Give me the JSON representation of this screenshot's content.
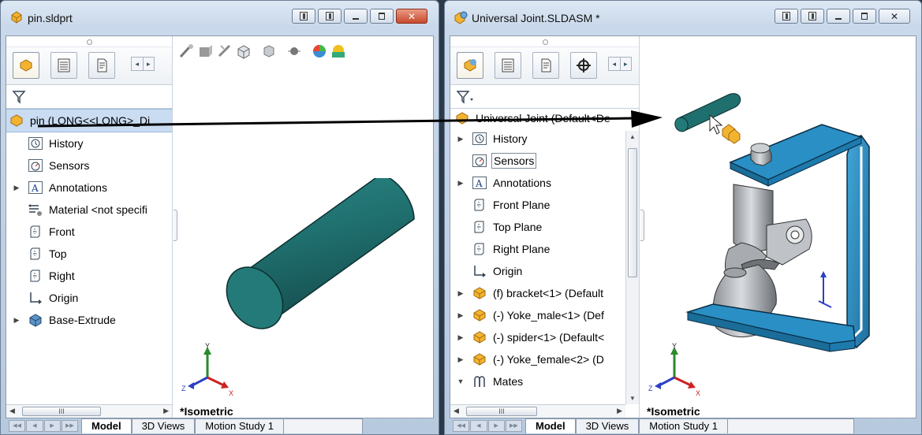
{
  "left_window": {
    "title": "pin.sldprt",
    "root_node": "pin (LONG<<LONG>_Di",
    "tree": [
      {
        "label": "History",
        "icon": "history-icon",
        "expander": ""
      },
      {
        "label": "Sensors",
        "icon": "sensors-icon",
        "expander": ""
      },
      {
        "label": "Annotations",
        "icon": "annotations-icon",
        "expander": "▶"
      },
      {
        "label": "Material <not specifi",
        "icon": "material-icon",
        "expander": ""
      },
      {
        "label": "Front",
        "icon": "plane-icon",
        "expander": ""
      },
      {
        "label": "Top",
        "icon": "plane-icon",
        "expander": ""
      },
      {
        "label": "Right",
        "icon": "plane-icon",
        "expander": ""
      },
      {
        "label": "Origin",
        "icon": "origin-icon",
        "expander": ""
      },
      {
        "label": "Base-Extrude",
        "icon": "extrude-icon",
        "expander": "▶"
      }
    ],
    "view_label": "*Isometric",
    "scroll_grip": "III",
    "tabs": [
      "Model",
      "3D Views",
      "Motion Study 1"
    ],
    "active_tab": "Model"
  },
  "right_window": {
    "title": "Universal Joint.SLDASM *",
    "root_node": "Universal Joint  (Default<De",
    "tree": [
      {
        "label": "History",
        "icon": "history-icon",
        "expander": "▶"
      },
      {
        "label": "Sensors",
        "icon": "sensors-icon",
        "expander": ""
      },
      {
        "label": "Annotations",
        "icon": "annotations-icon",
        "expander": "▶"
      },
      {
        "label": "Front Plane",
        "icon": "plane-icon",
        "expander": ""
      },
      {
        "label": "Top Plane",
        "icon": "plane-icon",
        "expander": ""
      },
      {
        "label": "Right Plane",
        "icon": "plane-icon",
        "expander": ""
      },
      {
        "label": "Origin",
        "icon": "origin-icon",
        "expander": ""
      },
      {
        "label": "(f) bracket<1> (Default",
        "icon": "component-icon",
        "expander": "▶"
      },
      {
        "label": "(-) Yoke_male<1> (Def",
        "icon": "component-icon",
        "expander": "▶"
      },
      {
        "label": "(-) spider<1> (Default<",
        "icon": "component-icon",
        "expander": "▶"
      },
      {
        "label": "(-) Yoke_female<2> (D",
        "icon": "component-icon",
        "expander": "▶"
      },
      {
        "label": "Mates",
        "icon": "mates-icon",
        "expander": "▼"
      }
    ],
    "view_label": "*Isometric",
    "scroll_grip": "III",
    "tabs": [
      "Model",
      "3D Views",
      "Motion Study 1"
    ],
    "active_tab": "Model"
  },
  "triad_axes": {
    "x": "X",
    "y": "Y",
    "z": "Z"
  },
  "colors": {
    "part_teal": "#1f6f6e",
    "bracket_blue": "#2a8fc4",
    "selection_blue": "#c9dcf2",
    "close_red": "#c74a2c"
  }
}
